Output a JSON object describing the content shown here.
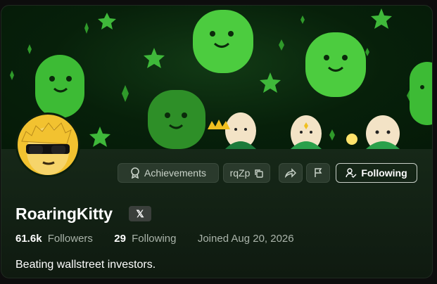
{
  "profile": {
    "name": "RoaringKitty",
    "social_badge": "𝕏",
    "bio": "Beating wallstreet investors.",
    "stats": {
      "followers_count": "61.6k",
      "followers_label": "Followers",
      "following_count": "29",
      "following_label": "Following",
      "joined": "Joined Aug 20, 2026"
    }
  },
  "actions": {
    "achievements_label": "Achievements",
    "code_label": "rqZp",
    "following_button_label": "Following"
  },
  "icons": {
    "achievements": "ribbon-icon",
    "copy": "copy-icon",
    "share": "share-icon",
    "report": "flag-icon",
    "following": "user-check-icon"
  },
  "colors": {
    "banner_green": "#4ccc3f",
    "avatar_yellow": "#f2c230",
    "button_bg": "#2a3a2c"
  }
}
